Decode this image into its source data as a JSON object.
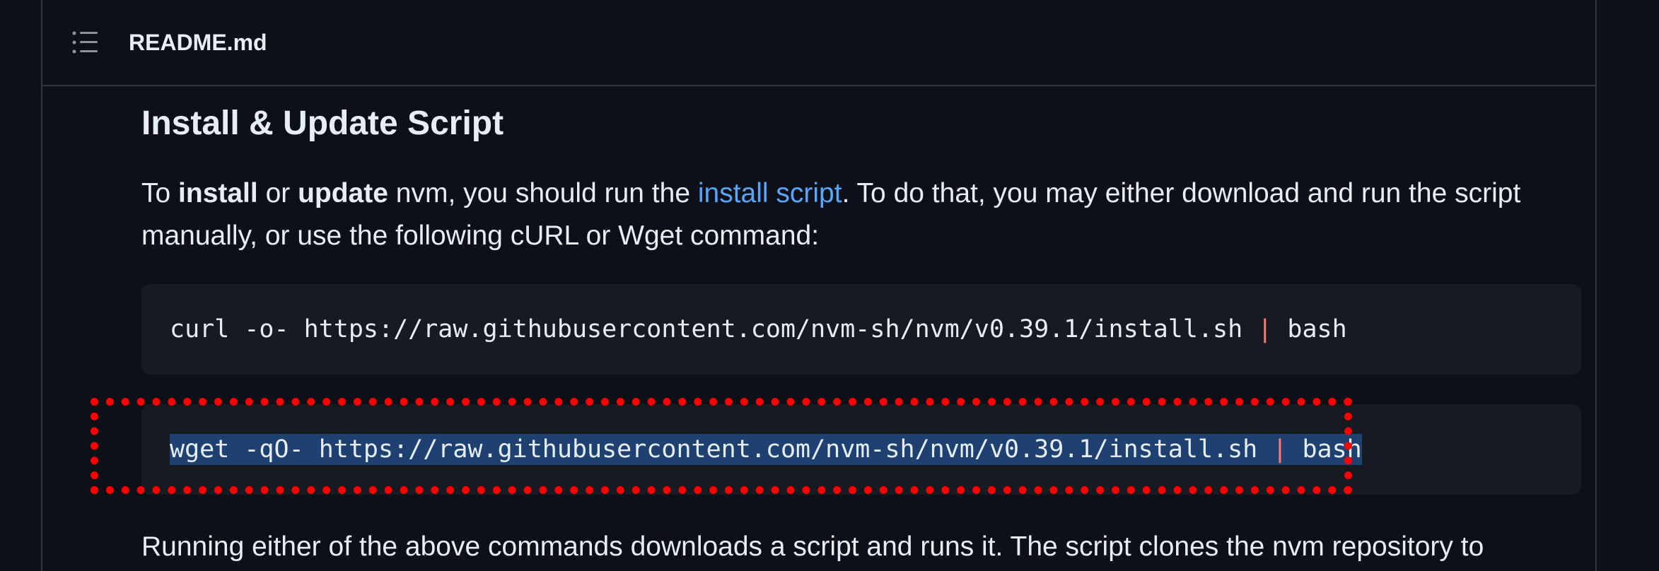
{
  "header": {
    "toc_icon": "list-unordered-icon",
    "title": "README.md"
  },
  "content": {
    "heading": "Install & Update Script",
    "intro": {
      "part1": "To ",
      "bold1": "install",
      "part2": " or ",
      "bold2": "update",
      "part3": " nvm, you should run the ",
      "link_text": "install script",
      "part4": ". To do that, you may either download and run the script manually, or use the following cURL or Wget command:"
    },
    "code_blocks": [
      {
        "before_pipe": "curl -o- https://raw.githubusercontent.com/nvm-sh/nvm/v0.39.1/install.sh ",
        "pipe": "|",
        "after_pipe": " bash"
      },
      {
        "before_pipe": "wget -qO- https://raw.githubusercontent.com/nvm-sh/nvm/v0.39.1/install.sh ",
        "pipe": "|",
        "after_pipe": " bash"
      }
    ],
    "followup": "Running either of the above commands downloads a script and runs it. The script clones the nvm repository to"
  },
  "colors": {
    "background": "#0d1117",
    "code_background": "#161b22",
    "link": "#58a6ff",
    "highlight_border": "#ff0000",
    "selection": "#1f4172"
  }
}
